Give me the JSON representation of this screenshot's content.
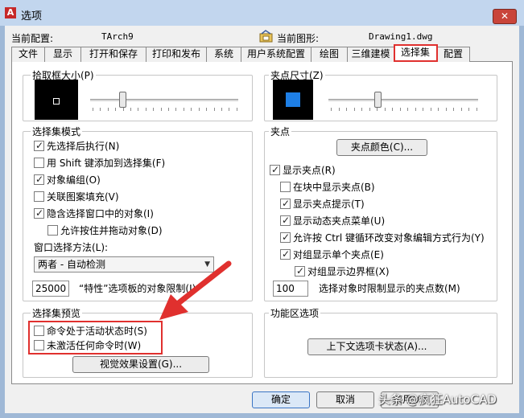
{
  "window": {
    "title": "选项",
    "app_icon": "A",
    "close_label": "✕"
  },
  "config": {
    "current_profile_label": "当前配置:",
    "current_profile_value": "TArch9",
    "current_drawing_label": "当前图形:",
    "current_drawing_value": "Drawing1.dwg",
    "drawing_icon": "drawing-file-icon"
  },
  "tabs": [
    {
      "label": "文件"
    },
    {
      "label": "显示"
    },
    {
      "label": "打开和保存"
    },
    {
      "label": "打印和发布"
    },
    {
      "label": "系统"
    },
    {
      "label": "用户系统配置"
    },
    {
      "label": "绘图"
    },
    {
      "label": "三维建模"
    },
    {
      "label": "选择集",
      "active": true
    },
    {
      "label": "配置"
    }
  ],
  "pickbox": {
    "label": "拾取框大小(P)",
    "slider_level": 0.22
  },
  "grip_size": {
    "label": "夹点尺寸(Z)",
    "slider_level": 0.33
  },
  "selection_modes": {
    "label": "选择集模式",
    "items": [
      {
        "label": "先选择后执行(N)",
        "checked": true
      },
      {
        "label": "用 Shift 键添加到选择集(F)",
        "checked": false
      },
      {
        "label": "对象编组(O)",
        "checked": true
      },
      {
        "label": "关联图案填充(V)",
        "checked": false
      },
      {
        "label": "隐含选择窗口中的对象(I)",
        "checked": true
      },
      {
        "label": "允许按住并拖动对象(D)",
        "checked": false
      }
    ],
    "window_method_label": "窗口选择方法(L):",
    "window_method_value": "两者 - 自动检测",
    "limit_value": "25000",
    "limit_label": "“特性”选项板的对象限制(J)"
  },
  "grips": {
    "label": "夹点",
    "color_button": "夹点颜色(C)...",
    "items": [
      {
        "label": "显示夹点(R)",
        "checked": true
      },
      {
        "label": "在块中显示夹点(B)",
        "checked": false
      },
      {
        "label": "显示夹点提示(T)",
        "checked": true
      },
      {
        "label": "显示动态夹点菜单(U)",
        "checked": true
      },
      {
        "label": "允许按 Ctrl 键循环改变对象编辑方式行为(Y)",
        "checked": true
      },
      {
        "label": "对组显示单个夹点(E)",
        "checked": true
      },
      {
        "label": "对组显示边界框(X)",
        "checked": true
      }
    ],
    "limit_value": "100",
    "limit_label": "选择对象时限制显示的夹点数(M)"
  },
  "preview": {
    "label": "选择集预览",
    "items": [
      {
        "label": "命令处于活动状态时(S)",
        "checked": false
      },
      {
        "label": "未激活任何命令时(W)",
        "checked": false
      }
    ],
    "visual_button": "视觉效果设置(G)..."
  },
  "ribbon": {
    "label": "功能区选项",
    "contextual_button": "上下文选项卡状态(A)..."
  },
  "footer": {
    "ok": "确定",
    "cancel": "取消",
    "apply": "应用(A)",
    "watermark": "头条 @疯狂AutoCAD"
  },
  "colors": {
    "highlight_red": "#e0302e",
    "grip_blue": "#1e7fe6"
  }
}
